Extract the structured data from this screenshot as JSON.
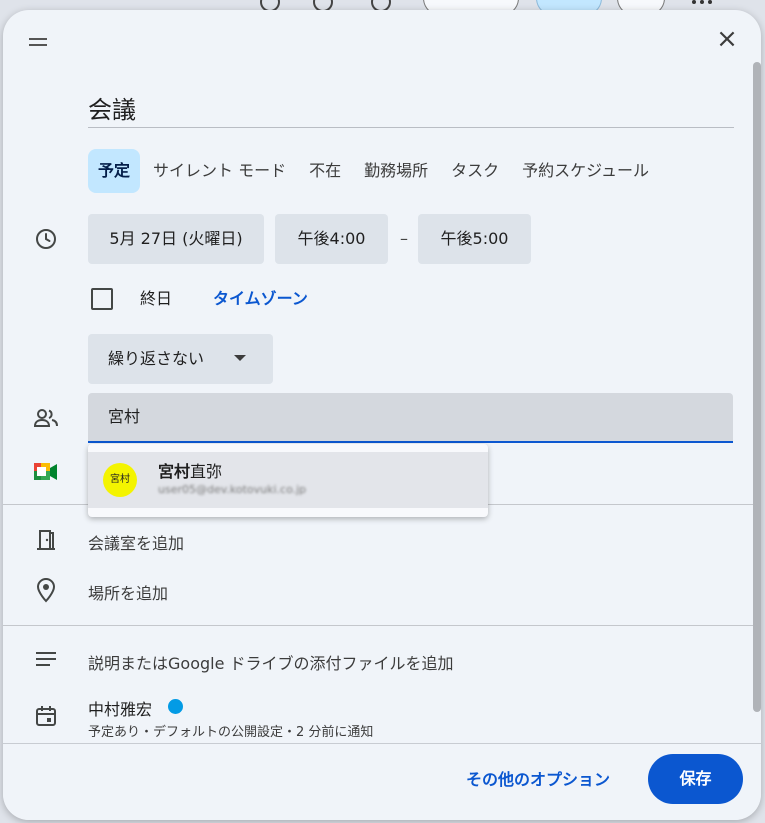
{
  "window": {
    "close_glyph": "×"
  },
  "event": {
    "title": "会議"
  },
  "event_types": [
    {
      "label": "予定",
      "selected": true
    },
    {
      "label": "サイレント モード",
      "selected": false
    },
    {
      "label": "不在",
      "selected": false
    },
    {
      "label": "勤務場所",
      "selected": false
    },
    {
      "label": "タスク",
      "selected": false
    },
    {
      "label": "予約スケジュール",
      "selected": false
    }
  ],
  "datetime": {
    "date": "5月 27日 (火曜日)",
    "start_time": "午後4:00",
    "separator": "–",
    "end_time": "午後5:00",
    "all_day_label": "終日",
    "all_day_checked": false,
    "timezone_link": "タイムゾーン"
  },
  "recurrence": {
    "value": "繰り返さない"
  },
  "guests": {
    "input_value": "宮村",
    "suggestion": {
      "avatar_text": "宮村",
      "name_match": "宮村",
      "name_rest": "直弥",
      "email": "user05@dev.kotovuki.co.jp"
    }
  },
  "rows": {
    "add_room": "会議室を追加",
    "add_location": "場所を追加",
    "add_description": "説明またはGoogle ドライブの添付ファイルを追加"
  },
  "owner": {
    "name": "中村雅宏",
    "details": "予定あり・デフォルトの公開設定・2 分前に通知"
  },
  "footer": {
    "more_options": "その他のオプション",
    "save": "保存"
  },
  "colors": {
    "accent": "#0b57d0",
    "selected_chip": "#c2e7ff",
    "owner_calendar": "#039be5",
    "avatar_bg": "#f4f400"
  }
}
